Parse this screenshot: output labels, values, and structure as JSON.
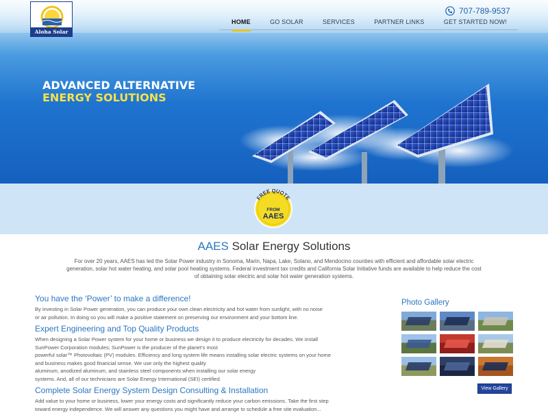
{
  "header": {
    "logo_text": "Aloha Solar",
    "phone": "707-789-9537",
    "nav": [
      {
        "label": "HOME",
        "active": true
      },
      {
        "label": "GO SOLAR",
        "active": false
      },
      {
        "label": "SERVICES",
        "active": false
      },
      {
        "label": "PARTNER LINKS",
        "active": false
      },
      {
        "label": "GET STARTED NOW!",
        "active": false
      }
    ]
  },
  "hero": {
    "headline_line1": "ADVANCED ALTERNATIVE",
    "headline_line2": "ENERGY SOLUTIONS"
  },
  "quote_badge": {
    "line1": "FREE QUOTE",
    "line2": "FROM",
    "line3": "AAES"
  },
  "intro": {
    "title_blue": "AAES",
    "title_rest": " Solar Energy Solutions",
    "text_lines": [
      "For over 20 years, AAES has led the Solar Power industry in Sonoma, Marin, Napa, Lake, Solano, and Mendocino counties with efficient and affordable solar electric",
      "generation, solar hot water heating, and solar pool heating systems. Federal investment tax credits and California Solar Initiative funds are available to help reduce the cost",
      "of obtaining solar electric and solar hot water generation systems."
    ]
  },
  "sections": [
    {
      "heading": "You have the ‘Power’ to make a difference!",
      "lines": [
        "By investing in Solar Power generation, you can produce your own clean electricity and hot water from sunlight, with no noise",
        "or air pollution. In doing so you will make a positive statement on preserving our environment and your bottom line."
      ]
    },
    {
      "heading": "Expert Engineering and Top Quality Products",
      "lines": [
        "When designing a Solar Power system for your home or business we design it to produce electricity for decades. We install",
        "SunPower Corporation modules; SunPower is the producer of the planet's most",
        "powerful solar™ Photovoltaic (PV) modules. Efficiency and long system life means installing solar electric systems on your home",
        "and business makes good financial sense. We use only the highest quality",
        "aluminum, anodized aluminum, and stainless steel components when installing our solar energy",
        "systems. And, all of our technicians are Solar Energy International (SEI) certified."
      ]
    },
    {
      "heading": "Complete Solar Energy System Design Consulting & Installation",
      "lines": [
        "Add value to your home or business, lower your energy costs and significantly reduce your carbon emissions. Take the first step",
        "toward energy independence. We will answer any questions you might have and arrange to schedule a free site evaluation..."
      ]
    }
  ],
  "gallery": {
    "title": "Photo Gallery",
    "button_label": "View Gallery",
    "thumbs": [
      {
        "name": "gallery-thumb-house-roof-panels",
        "sky": "#7fa9d6",
        "ground": "#6b7d5a",
        "accent": "#2c3e66"
      },
      {
        "name": "gallery-thumb-roof-array",
        "sky": "#5f89c4",
        "ground": "#5a6d86",
        "accent": "#1e2f57"
      },
      {
        "name": "gallery-thumb-house-yard",
        "sky": "#8db6e0",
        "ground": "#6f8a4c",
        "accent": "#c7c2b0"
      },
      {
        "name": "gallery-thumb-blue-house",
        "sky": "#9fc3e8",
        "ground": "#5b7640",
        "accent": "#3c5a8e"
      },
      {
        "name": "gallery-thumb-red-modules",
        "sky": "#c23a2e",
        "ground": "#8e1f1a",
        "accent": "#e3564a"
      },
      {
        "name": "gallery-thumb-farmhouse",
        "sky": "#a9c8e8",
        "ground": "#7b8c55",
        "accent": "#e2ddd0"
      },
      {
        "name": "gallery-thumb-ground-mount",
        "sky": "#9bbfe2",
        "ground": "#8d9a5e",
        "accent": "#2a3c6a"
      },
      {
        "name": "gallery-thumb-dark-array",
        "sky": "#2e3f64",
        "ground": "#1b2644",
        "accent": "#4d6498"
      },
      {
        "name": "gallery-thumb-tile-roof",
        "sky": "#c9772f",
        "ground": "#a5561f",
        "accent": "#1f2d55"
      }
    ]
  }
}
